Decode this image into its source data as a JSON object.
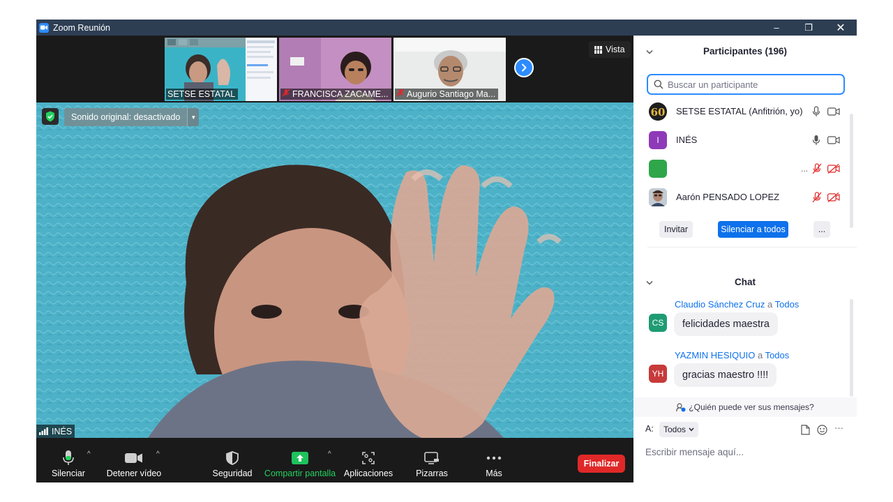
{
  "window": {
    "title": "Zoom Reunión",
    "minimize": "–",
    "restore": "❐",
    "close": "✕"
  },
  "thumbnails": [
    {
      "name": "SETSE ESTATAL",
      "muted": false
    },
    {
      "name": "FRANCISCA ZACAME...",
      "muted": true
    },
    {
      "name": "Augurio Santiago Ma...",
      "muted": true
    }
  ],
  "view_button": {
    "label": "Vista",
    "icon": "grid-icon"
  },
  "main_video": {
    "speaker": "INÉS",
    "original_sound": "Sonido original: desactivado",
    "background_color": "#4fb3c8"
  },
  "toolbar": {
    "mute": "Silenciar",
    "stop_video": "Detener vídeo",
    "security": "Seguridad",
    "share": "Compartir pantalla",
    "apps": "Aplicaciones",
    "whiteboards": "Pizarras",
    "more": "Más",
    "end": "Finalizar"
  },
  "participants": {
    "title": "Participantes (196)",
    "search_placeholder": "Buscar un participante",
    "list": [
      {
        "name": "SETSE ESTATAL (Anfitrión, yo)",
        "avatar": "60",
        "avatar_color": "#1a1a1a",
        "mic": "on",
        "video": "on"
      },
      {
        "name": "INÉS",
        "avatar": "I",
        "avatar_color": "#8e3ab8",
        "mic": "on",
        "video": "on"
      },
      {
        "name": "",
        "avatar": "",
        "avatar_color": "#2fa64a",
        "extra": "...",
        "mic": "off",
        "video": "off"
      },
      {
        "name": "Aarón PENSADO LOPEZ",
        "avatar": "",
        "avatar_color": "#9aa4ad",
        "mic": "off",
        "video": "off"
      }
    ],
    "invite": "Invitar",
    "mute_all": "Silenciar a todos",
    "more": "..."
  },
  "chat": {
    "title": "Chat",
    "messages": [
      {
        "initials": "CS",
        "color": "#1f9b73",
        "sender": "Claudio Sánchez Cruz",
        "to_word": "a",
        "to": "Todos",
        "text": "felicidades maestra"
      },
      {
        "initials": "YH",
        "color": "#c73a3a",
        "sender": "YAZMIN HESIQUIO",
        "to_word": "a",
        "to": "Todos",
        "text": "gracias maestro !!!!"
      }
    ],
    "who_can_see": "¿Quién puede ver sus mensajes?",
    "to_label": "A:",
    "to_value": "Todos",
    "input_placeholder": "Escribir mensaje aquí...",
    "more": "···"
  },
  "colors": {
    "accent": "#2d8cff",
    "end": "#e02828",
    "share": "#1fc25c",
    "titlebar": "#2d3e53"
  }
}
